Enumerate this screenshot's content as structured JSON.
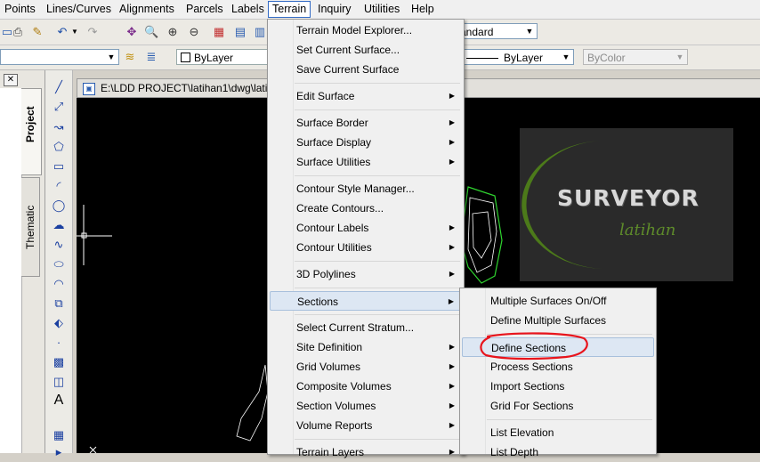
{
  "menubar": {
    "items": [
      "Points",
      "Lines/Curves",
      "Alignments",
      "Parcels",
      "Labels",
      "Terrain",
      "Inquiry",
      "Utilities",
      "Help"
    ]
  },
  "toolbar": {
    "text_style_value": "andard",
    "layer_value": "ByLayer",
    "linetype_value": "ByLayer",
    "color_value": "ByColor"
  },
  "left_panel": {
    "tab_project": "Project",
    "tab_thematic": "Thematic"
  },
  "drawing": {
    "title": "E:\\LDD PROJECT\\latihan1\\dwg\\latih",
    "logo_main": "SURVEYOR",
    "logo_sub": "latihan"
  },
  "terrain_menu": {
    "items": [
      {
        "label": "Terrain Model Explorer...",
        "submenu": false
      },
      {
        "label": "Set Current Surface...",
        "submenu": false
      },
      {
        "label": "Save Current Surface",
        "submenu": false
      },
      {
        "label": "Edit Surface",
        "submenu": true
      },
      {
        "label": "Surface Border",
        "submenu": true
      },
      {
        "label": "Surface Display",
        "submenu": true
      },
      {
        "label": "Surface Utilities",
        "submenu": true
      },
      {
        "label": "Contour Style Manager...",
        "submenu": false
      },
      {
        "label": "Create Contours...",
        "submenu": false
      },
      {
        "label": "Contour Labels",
        "submenu": true
      },
      {
        "label": "Contour Utilities",
        "submenu": true
      },
      {
        "label": "3D Polylines",
        "submenu": true
      },
      {
        "label": "Sections",
        "submenu": true
      },
      {
        "label": "Select Current Stratum...",
        "submenu": false
      },
      {
        "label": "Site Definition",
        "submenu": true
      },
      {
        "label": "Grid Volumes",
        "submenu": true
      },
      {
        "label": "Composite Volumes",
        "submenu": true
      },
      {
        "label": "Section Volumes",
        "submenu": true
      },
      {
        "label": "Volume Reports",
        "submenu": true
      },
      {
        "label": "Terrain Layers",
        "submenu": true
      }
    ]
  },
  "sections_menu": {
    "items": [
      "Multiple Surfaces On/Off",
      "Define Multiple Surfaces",
      "Define Sections",
      "Process Sections",
      "Import Sections",
      "Grid For Sections",
      "List Elevation",
      "List Depth"
    ]
  },
  "colors": {
    "menu_highlight": "#dde7f3",
    "annotation_circle": "#e8141c",
    "canvas_bg": "#000000",
    "logo_green": "#4c7a1a"
  }
}
